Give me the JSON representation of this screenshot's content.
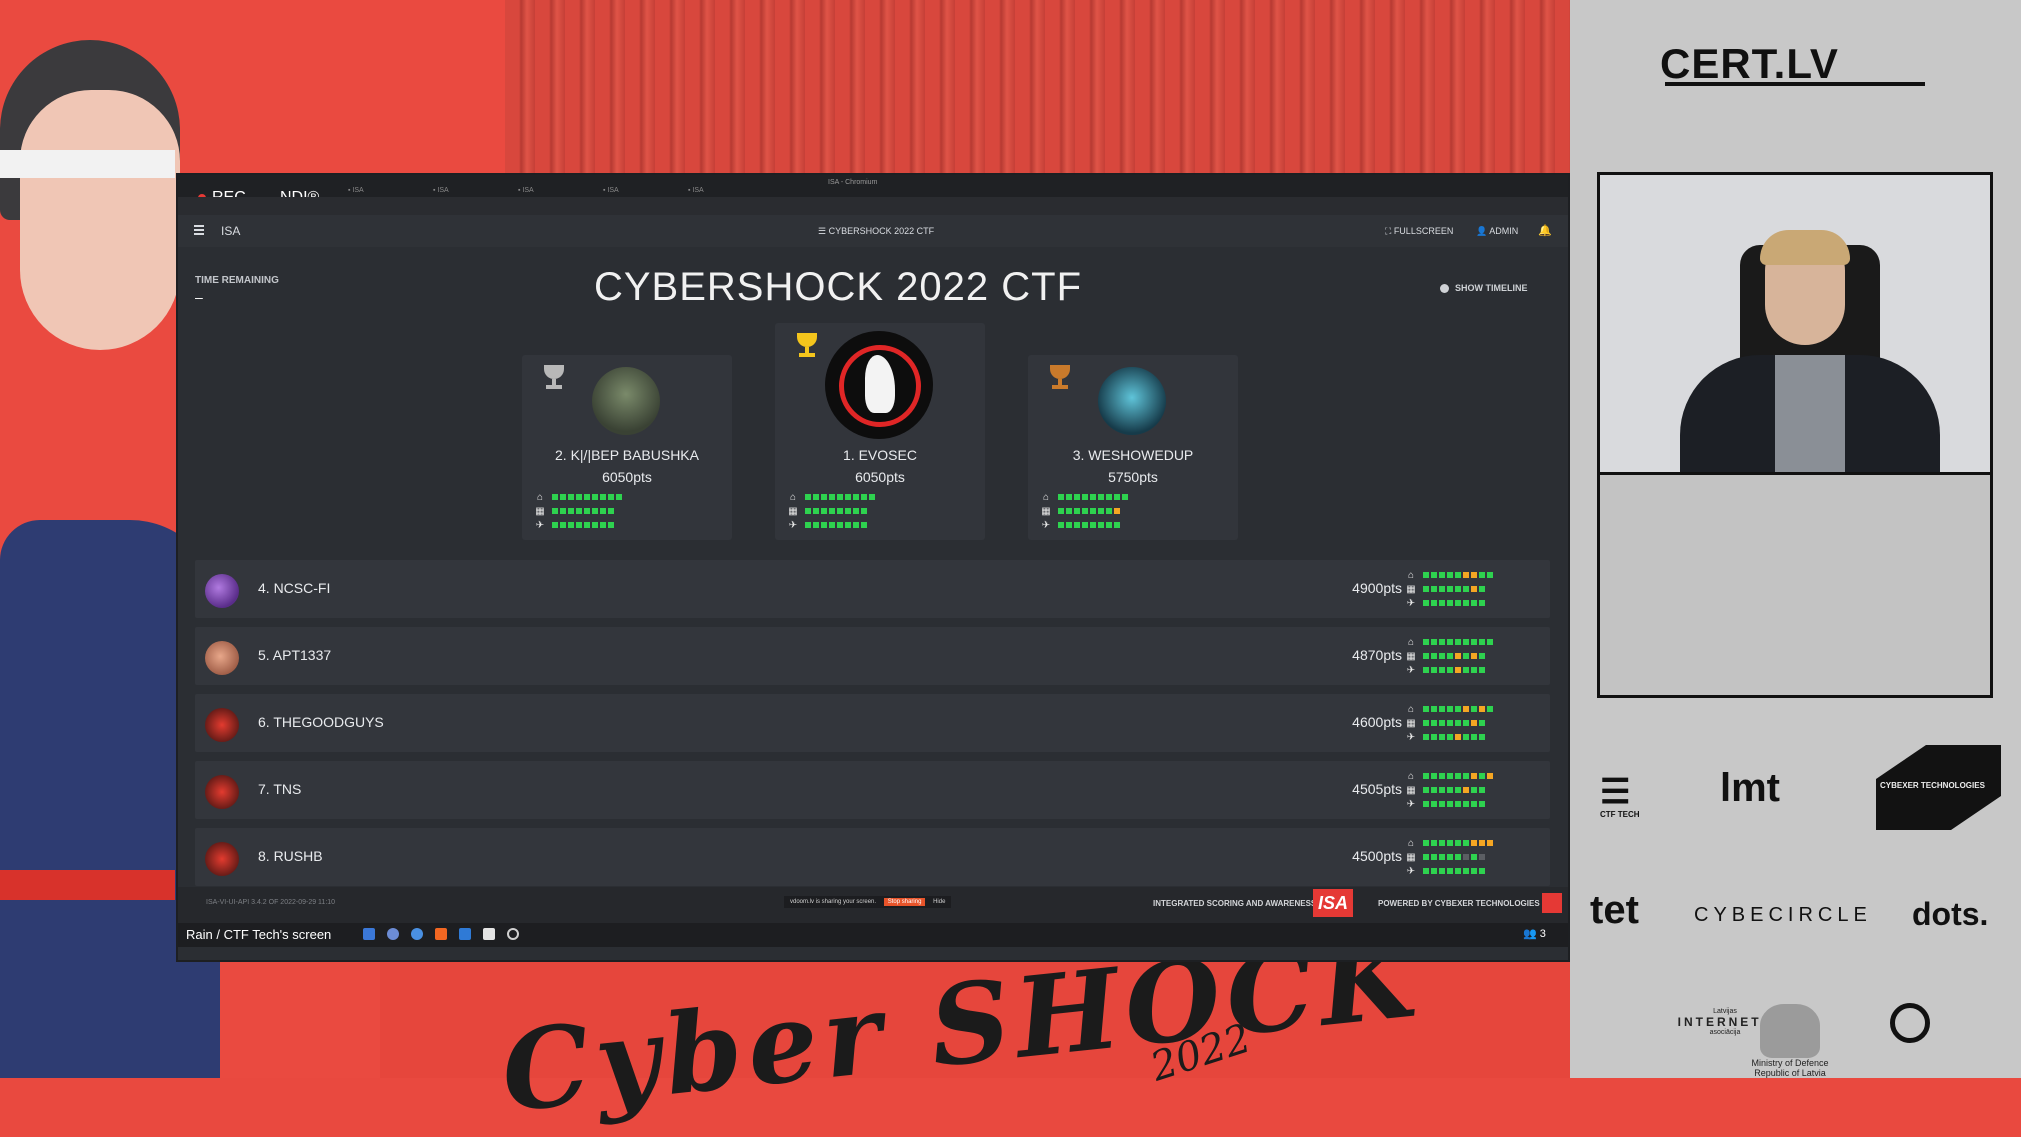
{
  "stream": {
    "rec_label": "REC",
    "ndi_label": "NDI®",
    "share_label": "Rain / CTF Tech's screen",
    "bottom_title": "Cyber SHOCK",
    "bottom_year": "2022"
  },
  "browser": {
    "window_title": "ISA - Chromium"
  },
  "app": {
    "menu_icon": "hamburger-icon",
    "brand": "ISA",
    "center_title": "CYBERSHOCK 2022 CTF",
    "fullscreen_label": "FULLSCREEN",
    "admin_label": "ADMIN",
    "time_remaining_label": "TIME REMAINING",
    "time_remaining_value": "–",
    "page_title": "CYBERSHOCK 2022 CTF",
    "show_timeline_label": "SHOW TIMELINE"
  },
  "podium": [
    {
      "rank_name": "2. K|/|BEP BABUSHKA",
      "points": "6050pts",
      "trophy": "silver",
      "trophy_color": "#b8b8b8"
    },
    {
      "rank_name": "1. EVOSEC",
      "points": "6050pts",
      "trophy": "gold",
      "trophy_color": "#f4c51c"
    },
    {
      "rank_name": "3. WESHOWEDUP",
      "points": "5750pts",
      "trophy": "bronze",
      "trophy_color": "#c97a2b"
    }
  ],
  "leaderboard": [
    {
      "rank_name": "4. NCSC-FI",
      "points": "4900pts"
    },
    {
      "rank_name": "5. APT1337",
      "points": "4870pts"
    },
    {
      "rank_name": "6. THEGOODGUYS",
      "points": "4600pts"
    },
    {
      "rank_name": "7. TNS",
      "points": "4505pts"
    },
    {
      "rank_name": "8. RUSHB",
      "points": "4500pts"
    }
  ],
  "footer": {
    "version": "ISA-VI-UI-API 3.4.2 OF 2022-09-29 11:10",
    "sharing_notice": "vdoom.lv is sharing your screen.",
    "stop_sharing": "Stop sharing",
    "hide": "Hide",
    "integrated_label": "INTEGRATED SCORING AND AWARENESS",
    "isa_logo": "ISA",
    "powered_label": "POWERED BY CYBEXER TECHNOLOGIES"
  },
  "sponsors": {
    "cert": "CERT.LV",
    "ctf_tech": "CTF TECH",
    "imt": "lmt",
    "cybexer": "CYBEXER TECHNOLOGIES",
    "tet": "tet",
    "cybecircle": "CYBECIRCLE",
    "dots": "dots.",
    "lia_line1": "Latvijas",
    "lia_line2": "INTERNETA",
    "lia_line3": "asociācija",
    "mod_line1": "Ministry of Defence",
    "mod_line2": "Republic of Latvia"
  },
  "colors": {
    "green": "#2ed24f",
    "orange": "#f5a623",
    "panel_bg": "#2b2e33",
    "accent_red": "#e53935"
  },
  "taskbar": {
    "participants_count": "3"
  }
}
